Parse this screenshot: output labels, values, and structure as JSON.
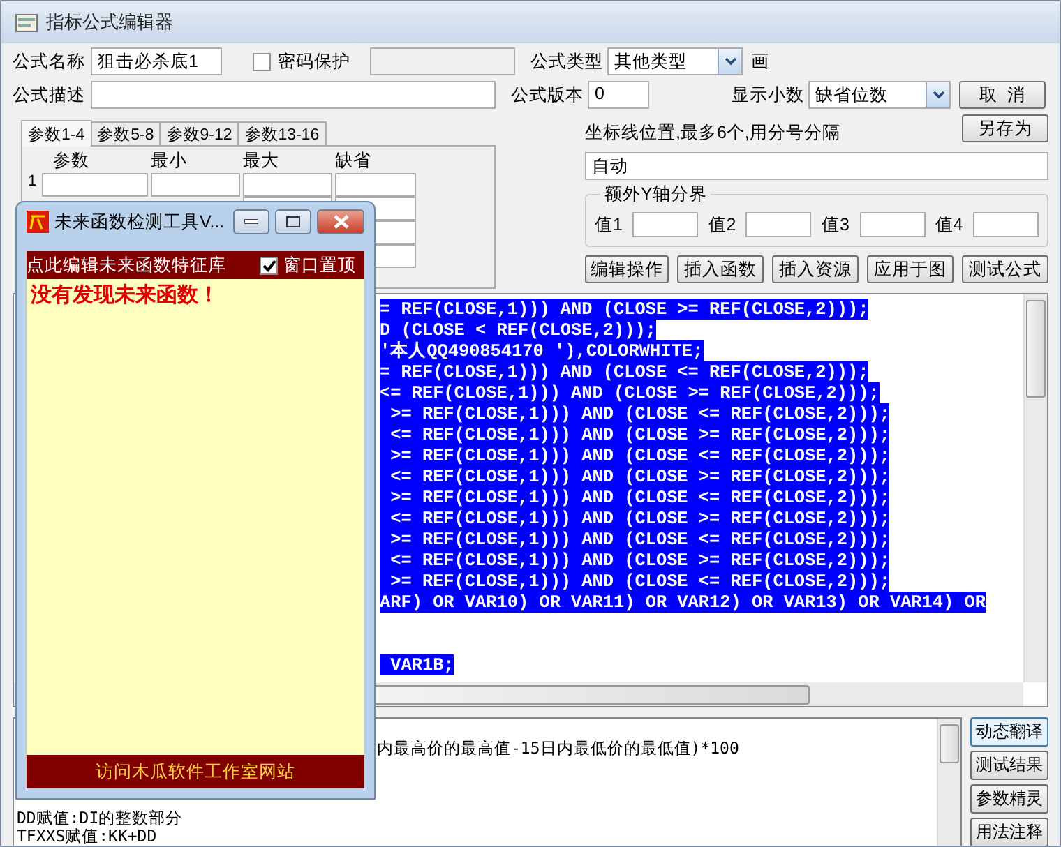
{
  "window": {
    "title": "指标公式编辑器"
  },
  "form": {
    "name_label": "公式名称",
    "name_value": "狙击必杀底1",
    "password": {
      "label": "密码保护",
      "checked": false
    },
    "type_label": "公式类型",
    "type_value": "其他类型",
    "draw_label": "画",
    "desc_label": "公式描述",
    "version_label": "公式版本",
    "version_value": "0",
    "decimals_label": "显示小数",
    "decimals_value": "缺省位数"
  },
  "cancel_button": "取  消",
  "save_as_button": "另存为",
  "param_tabs": [
    {
      "label": "参数1-4",
      "selected": true
    },
    {
      "label": "参数5-8",
      "selected": false
    },
    {
      "label": "参数9-12",
      "selected": false
    },
    {
      "label": "参数13-16",
      "selected": false
    }
  ],
  "param_table": {
    "columns": [
      "参数",
      "最小",
      "最大",
      "缺省"
    ],
    "rows": [
      {
        "label": "1"
      },
      {
        "label": null
      },
      {
        "label": null
      },
      {
        "label": null
      }
    ]
  },
  "axis": {
    "label": "坐标线位置,最多6个,用分号分隔",
    "value": "自动"
  },
  "y_bounds": {
    "title": "额外Y轴分界",
    "fields": [
      "值1",
      "值2",
      "值3",
      "值4"
    ]
  },
  "action_buttons": [
    "编辑操作",
    "插入函数",
    "插入资源",
    "应用于图",
    "测试公式"
  ],
  "code_lines": [
    {
      "kind": "text",
      "text": "= REF(CLOSE,1))) AND (CLOSE >= REF(CLOSE,2)));"
    },
    {
      "kind": "text",
      "text": "D (CLOSE < REF(CLOSE,2)));"
    },
    {
      "kind": "text",
      "text": "'本人QQ490854170 '),COLORWHITE;"
    },
    {
      "kind": "text",
      "text": "= REF(CLOSE,1))) AND (CLOSE <= REF(CLOSE,2)));"
    },
    {
      "kind": "text",
      "text": "<= REF(CLOSE,1))) AND (CLOSE >= REF(CLOSE,2)));"
    },
    {
      "kind": "text",
      "text": " >= REF(CLOSE,1))) AND (CLOSE <= REF(CLOSE,2)));"
    },
    {
      "kind": "text",
      "text": " <= REF(CLOSE,1))) AND (CLOSE >= REF(CLOSE,2)));"
    },
    {
      "kind": "text",
      "text": " >= REF(CLOSE,1))) AND (CLOSE <= REF(CLOSE,2)));"
    },
    {
      "kind": "text",
      "text": " <= REF(CLOSE,1))) AND (CLOSE >= REF(CLOSE,2)));"
    },
    {
      "kind": "text",
      "text": " >= REF(CLOSE,1))) AND (CLOSE <= REF(CLOSE,2)));"
    },
    {
      "kind": "text",
      "text": " <= REF(CLOSE,1))) AND (CLOSE >= REF(CLOSE,2)));"
    },
    {
      "kind": "text",
      "text": " >= REF(CLOSE,1))) AND (CLOSE <= REF(CLOSE,2)));"
    },
    {
      "kind": "text",
      "text": " <= REF(CLOSE,1))) AND (CLOSE >= REF(CLOSE,2)));"
    },
    {
      "kind": "text",
      "text": " >= REF(CLOSE,1))) AND (CLOSE <= REF(CLOSE,2)));"
    },
    {
      "kind": "text",
      "text": "ARF) OR VAR10) OR VAR11) OR VAR12) OR VAR13) OR VAR14) OR"
    },
    {
      "kind": "blank"
    },
    {
      "kind": "blank"
    },
    {
      "kind": "text",
      "text": " VAR1B;"
    }
  ],
  "description_lines": [
    {
      "kind": "cut",
      "text": "内最高价的最高值-15日内最低价的最低值)*100"
    },
    {
      "kind": "blank"
    },
    {
      "kind": "blank"
    },
    {
      "kind": "blank"
    },
    {
      "kind": "full",
      "text": "DD赋值:DI的整数部分"
    },
    {
      "kind": "full",
      "text": "TFXXS赋值:KK+DD"
    }
  ],
  "side_buttons": [
    {
      "label": "动态翻译",
      "selected": true
    },
    {
      "label": "测试结果",
      "selected": false
    },
    {
      "label": "参数精灵",
      "selected": false
    },
    {
      "label": "用法注释",
      "selected": false
    }
  ],
  "detector": {
    "title": "未来函数检测工具V...",
    "edit_link": "点此编辑未来函数特征库",
    "pin": {
      "label": "窗口置顶",
      "checked": true
    },
    "result": "没有发现未来函数！",
    "footer_link": "访问木瓜软件工作室网站"
  }
}
